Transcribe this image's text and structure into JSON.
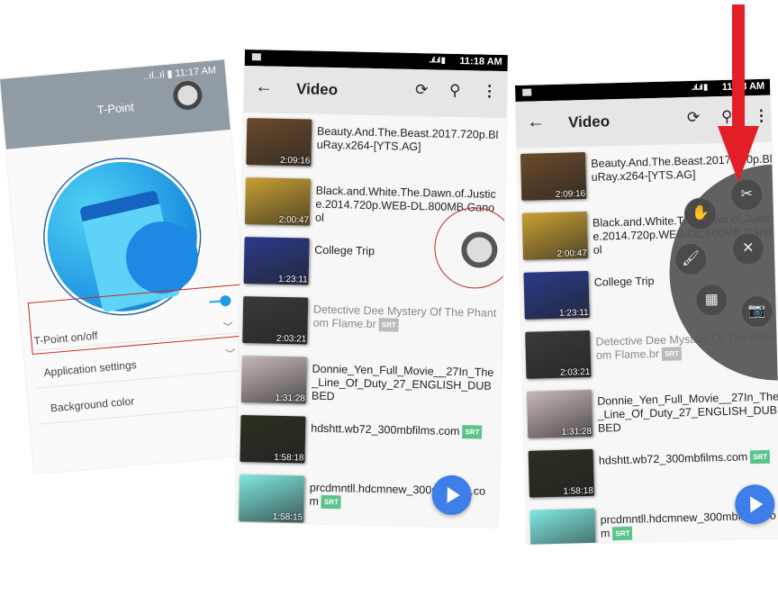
{
  "tpoint": {
    "status_time": "11:17 AM",
    "signal": "..ıl..ıl ▮",
    "title": "T-Point",
    "settings": [
      {
        "label": "T-Point on/off",
        "enabled": true
      },
      {
        "label": "Application settings"
      },
      {
        "label": "Background color"
      }
    ]
  },
  "video1": {
    "status_time": "11:18 AM",
    "signal": "..ıl..ıl ▮",
    "title": "Video"
  },
  "video2": {
    "status_time": "11:18 AM",
    "signal": "..ıl..ıl ▮",
    "title": "Video"
  },
  "toolbar": {
    "back_icon": "←",
    "refresh_icon": "⟳",
    "search_icon": "⚲",
    "more_icon": "⋮"
  },
  "videos": [
    {
      "name": "Beauty.And.The.Beast.2017.720p.BluRay.x264-[YTS.AG]",
      "duration": "2:09:16",
      "srt": "",
      "thumb": "#6b4a2a"
    },
    {
      "name": "Black.and.White.The.Dawn.of.Justice.2014.720p.WEB-DL.800MB.Ganool",
      "duration": "2:00:47",
      "srt": "",
      "thumb": "#c8a032"
    },
    {
      "name": "College Trip",
      "duration": "1:23:11",
      "srt": "",
      "thumb": "#2a3a8a"
    },
    {
      "name": "Detective Dee Mystery Of The Phantom Flame.br",
      "duration": "2:03:21",
      "srt": "SRT",
      "thumb": "#3a3a3a",
      "dim": true
    },
    {
      "name": "Donnie_Yen_Full_Movie__27In_The_Line_Of_Duty_27_ENGLISH_DUBBED",
      "duration": "1:31:28",
      "srt": "",
      "thumb": "#c8b8b8"
    },
    {
      "name": "hdshtt.wb72_300mbfilms.com",
      "duration": "1:58:18",
      "srt": "SRT",
      "thumb": "#2a3020"
    },
    {
      "name": "prcdmntll.hdcmnew_300mbfilms.com",
      "duration": "1:58:15",
      "srt": "SRT",
      "thumb": "#7fe8e0"
    }
  ],
  "menu": {
    "items": [
      "screenshot-cut-icon",
      "hand-gesture-icon",
      "clean-brush-icon",
      "close-icon",
      "apps-grid-icon",
      "camera-icon"
    ],
    "glyphs": [
      "✂",
      "✋",
      "🖌",
      "✕",
      "▦",
      "📷"
    ]
  },
  "colors": {
    "accent": "#3d7ee8",
    "highlight": "#c62828",
    "arrow": "#e41e26",
    "srt": "#5cc38a"
  }
}
